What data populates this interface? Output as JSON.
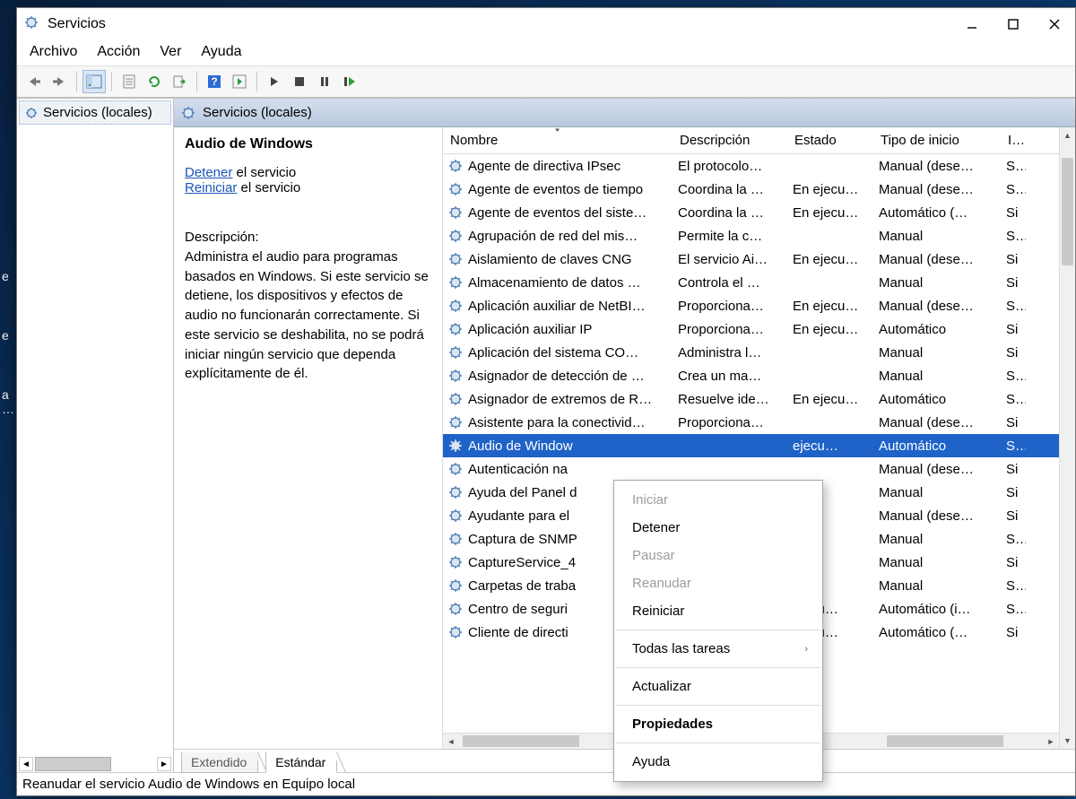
{
  "window": {
    "title": "Servicios"
  },
  "menu": {
    "items": [
      "Archivo",
      "Acción",
      "Ver",
      "Ayuda"
    ]
  },
  "tree": {
    "root": "Servicios (locales)"
  },
  "header": {
    "label": "Servicios (locales)"
  },
  "detail": {
    "title": "Audio de Windows",
    "stop_link": "Detener",
    "stop_rest": " el servicio",
    "restart_link": "Reiniciar",
    "restart_rest": " el servicio",
    "desc_label": "Descripción:",
    "description": "Administra el audio para programas basados en Windows. Si este servicio se detiene, los dispositivos y efectos de audio no funcionarán correctamente. Si este servicio se deshabilita, no se podrá iniciar ningún servicio que dependa explícitamente de él."
  },
  "columns": {
    "name": "Nombre",
    "desc": "Descripción",
    "state": "Estado",
    "startup": "Tipo de inicio",
    "logon": "In"
  },
  "services": [
    {
      "name": "Agente de directiva IPsec",
      "desc": "El protocolo…",
      "state": "",
      "startup": "Manual (dese…",
      "logon": "Se"
    },
    {
      "name": "Agente de eventos de tiempo",
      "desc": "Coordina la …",
      "state": "En ejecu…",
      "startup": "Manual (dese…",
      "logon": "Se"
    },
    {
      "name": "Agente de eventos del siste…",
      "desc": "Coordina la …",
      "state": "En ejecu…",
      "startup": "Automático (…",
      "logon": "Si"
    },
    {
      "name": "Agrupación de red del mis…",
      "desc": "Permite la c…",
      "state": "",
      "startup": "Manual",
      "logon": "Se"
    },
    {
      "name": "Aislamiento de claves CNG",
      "desc": "El servicio Ai…",
      "state": "En ejecu…",
      "startup": "Manual (dese…",
      "logon": "Si"
    },
    {
      "name": "Almacenamiento de datos …",
      "desc": "Controla el …",
      "state": "",
      "startup": "Manual",
      "logon": "Si"
    },
    {
      "name": "Aplicación auxiliar de NetBI…",
      "desc": "Proporciona…",
      "state": "En ejecu…",
      "startup": "Manual (dese…",
      "logon": "Se"
    },
    {
      "name": "Aplicación auxiliar IP",
      "desc": "Proporciona…",
      "state": "En ejecu…",
      "startup": "Automático",
      "logon": "Si"
    },
    {
      "name": "Aplicación del sistema CO…",
      "desc": "Administra l…",
      "state": "",
      "startup": "Manual",
      "logon": "Si"
    },
    {
      "name": "Asignador de detección de …",
      "desc": "Crea un ma…",
      "state": "",
      "startup": "Manual",
      "logon": "Se"
    },
    {
      "name": "Asignador de extremos de R…",
      "desc": "Resuelve ide…",
      "state": "En ejecu…",
      "startup": "Automático",
      "logon": "Se"
    },
    {
      "name": "Asistente para la conectivid…",
      "desc": "Proporciona…",
      "state": "",
      "startup": "Manual (dese…",
      "logon": "Si"
    },
    {
      "name": "Audio de Windows",
      "desc": "",
      "state": "ejecu…",
      "startup": "Automático",
      "logon": "Se",
      "selected": true,
      "truncName": "Audio de Window"
    },
    {
      "name": "Autenticación na",
      "desc": "",
      "state": "",
      "startup": "Manual (dese…",
      "logon": "Si"
    },
    {
      "name": "Ayuda del Panel d",
      "desc": "",
      "state": "",
      "startup": "Manual",
      "logon": "Si"
    },
    {
      "name": "Ayudante para el",
      "desc": "",
      "state": "",
      "startup": "Manual (dese…",
      "logon": "Si"
    },
    {
      "name": "Captura de SNMP",
      "desc": "",
      "state": "",
      "startup": "Manual",
      "logon": "Se"
    },
    {
      "name": "CaptureService_4",
      "desc": "",
      "state": "",
      "startup": "Manual",
      "logon": "Si"
    },
    {
      "name": "Carpetas de traba",
      "desc": "",
      "state": "",
      "startup": "Manual",
      "logon": "Se"
    },
    {
      "name": "Centro de seguri",
      "desc": "",
      "state": "ejecu…",
      "startup": "Automático (i…",
      "logon": "Se"
    },
    {
      "name": "Cliente de directi",
      "desc": "",
      "state": "ejecu…",
      "startup": "Automático (…",
      "logon": "Si"
    }
  ],
  "selected_index": 12,
  "tabs": {
    "extended": "Extendido",
    "standard": "Estándar"
  },
  "status": "Reanudar el servicio Audio de Windows en Equipo local",
  "context": {
    "items": [
      {
        "label": "Iniciar",
        "disabled": true
      },
      {
        "label": "Detener"
      },
      {
        "label": "Pausar",
        "disabled": true
      },
      {
        "label": "Reanudar",
        "disabled": true
      },
      {
        "label": "Reiniciar"
      },
      {
        "sep": true
      },
      {
        "label": "Todas las tareas",
        "submenu": true
      },
      {
        "sep": true
      },
      {
        "label": "Actualizar"
      },
      {
        "sep": true
      },
      {
        "label": "Propiedades",
        "bold": true
      },
      {
        "sep": true
      },
      {
        "label": "Ayuda"
      }
    ]
  }
}
